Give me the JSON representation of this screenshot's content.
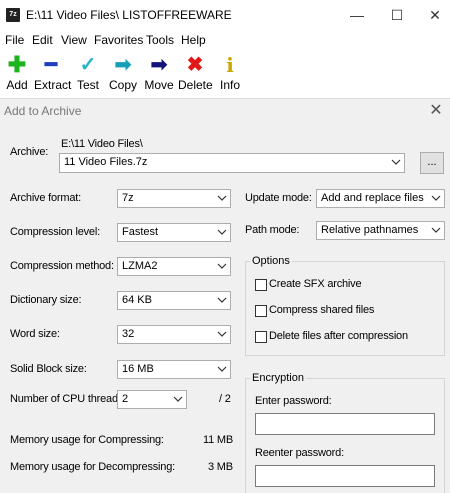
{
  "window": {
    "title": "E:\\11 Video Files\\ LISTOFFREEWARE",
    "app_icon": "7z",
    "minimize": "—",
    "maximize": "☐",
    "close": "✕"
  },
  "menu": [
    "File",
    "Edit",
    "View",
    "Favorites",
    "Tools",
    "Help"
  ],
  "toolbar": [
    {
      "label": "Add",
      "icon": "plus-icon",
      "glyph": "✚",
      "color": "#1db31d"
    },
    {
      "label": "Extract",
      "icon": "minus-icon",
      "glyph": "━",
      "color": "#1f3fbf"
    },
    {
      "label": "Test",
      "icon": "check-chevron-icon",
      "glyph": "✓",
      "color": "#27b5c9"
    },
    {
      "label": "Copy",
      "icon": "double-arrow-icon",
      "glyph": "➡",
      "color": "#16a0b8"
    },
    {
      "label": "Move",
      "icon": "arrow-right-icon",
      "glyph": "➡",
      "color": "#14147a"
    },
    {
      "label": "Delete",
      "icon": "x-icon",
      "glyph": "✖",
      "color": "#e01818"
    },
    {
      "label": "Info",
      "icon": "info-icon",
      "glyph": "i",
      "color": "#c9a800"
    }
  ],
  "dialog": {
    "title": "Add to Archive",
    "close": "✕",
    "archive_label": "Archive:",
    "archive_path": "E:\\11 Video Files\\",
    "archive_name": "11 Video Files.7z",
    "browse_label": "...",
    "left_fields": [
      {
        "label": "Archive format:",
        "value": "7z"
      },
      {
        "label": "Compression level:",
        "value": "Fastest"
      },
      {
        "label": "Compression method:",
        "value": "LZMA2"
      },
      {
        "label": "Dictionary size:",
        "value": "64 KB"
      },
      {
        "label": "Word size:",
        "value": "32"
      },
      {
        "label": "Solid Block size:",
        "value": "16 MB"
      }
    ],
    "cpu_label": "Number of CPU threads:",
    "cpu_value": "2",
    "cpu_total": "/ 2",
    "memory": [
      {
        "label": "Memory usage for Compressing:",
        "value": "11 MB"
      },
      {
        "label": "Memory usage for Decompressing:",
        "value": "3 MB"
      }
    ],
    "update_mode_label": "Update mode:",
    "update_mode_value": "Add and replace files",
    "path_mode_label": "Path mode:",
    "path_mode_value": "Relative pathnames",
    "options_title": "Options",
    "options": [
      {
        "label": "Create SFX archive",
        "checked": false
      },
      {
        "label": "Compress shared files",
        "checked": false
      },
      {
        "label": "Delete files after compression",
        "checked": false
      }
    ],
    "encryption_title": "Encryption",
    "enter_password_label": "Enter password:",
    "reenter_password_label": "Reenter password:"
  }
}
